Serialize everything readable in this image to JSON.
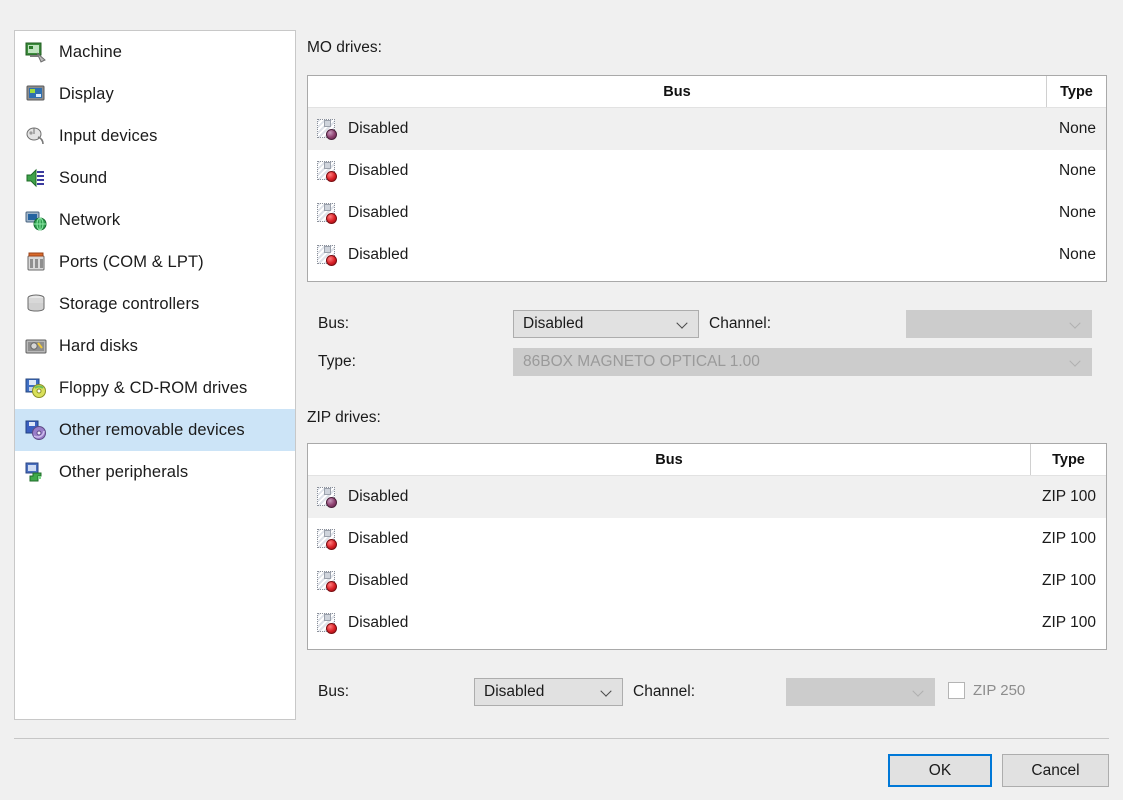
{
  "sidebar": {
    "items": [
      {
        "label": "Machine",
        "icon": "machine-icon",
        "selected": false
      },
      {
        "label": "Display",
        "icon": "display-icon",
        "selected": false
      },
      {
        "label": "Input devices",
        "icon": "input-devices-icon",
        "selected": false
      },
      {
        "label": "Sound",
        "icon": "sound-icon",
        "selected": false
      },
      {
        "label": "Network",
        "icon": "network-icon",
        "selected": false
      },
      {
        "label": "Ports (COM & LPT)",
        "icon": "ports-icon",
        "selected": false
      },
      {
        "label": "Storage controllers",
        "icon": "storage-controllers-icon",
        "selected": false
      },
      {
        "label": "Hard disks",
        "icon": "hard-disks-icon",
        "selected": false
      },
      {
        "label": "Floppy & CD-ROM drives",
        "icon": "floppy-cdrom-icon",
        "selected": false
      },
      {
        "label": "Other removable devices",
        "icon": "removable-devices-icon",
        "selected": true
      },
      {
        "label": "Other peripherals",
        "icon": "other-peripherals-icon",
        "selected": false
      }
    ]
  },
  "mo_section": {
    "title": "MO drives:",
    "columns": {
      "bus": "Bus",
      "type": "Type"
    },
    "rows": [
      {
        "bus": "Disabled",
        "type": "None",
        "selected": true
      },
      {
        "bus": "Disabled",
        "type": "None",
        "selected": false
      },
      {
        "bus": "Disabled",
        "type": "None",
        "selected": false
      },
      {
        "bus": "Disabled",
        "type": "None",
        "selected": false
      }
    ],
    "bus_label": "Bus:",
    "bus_value": "Disabled",
    "channel_label": "Channel:",
    "channel_value": "",
    "type_label": "Type:",
    "type_value": "86BOX MAGNETO OPTICAL 1.00"
  },
  "zip_section": {
    "title": "ZIP drives:",
    "columns": {
      "bus": "Bus",
      "type": "Type"
    },
    "rows": [
      {
        "bus": "Disabled",
        "type": "ZIP 100",
        "selected": true
      },
      {
        "bus": "Disabled",
        "type": "ZIP 100",
        "selected": false
      },
      {
        "bus": "Disabled",
        "type": "ZIP 100",
        "selected": false
      },
      {
        "bus": "Disabled",
        "type": "ZIP 100",
        "selected": false
      }
    ],
    "bus_label": "Bus:",
    "bus_value": "Disabled",
    "channel_label": "Channel:",
    "channel_value": "",
    "zip250_label": "ZIP 250",
    "zip250_checked": false
  },
  "footer": {
    "ok_label": "OK",
    "cancel_label": "Cancel"
  },
  "colors": {
    "window_bg": "#f0f0f0",
    "selection_blue": "#cce4f7",
    "row_selection": "#f0f0f0",
    "accent_focus": "#0078d7",
    "text": "#1b1b1b",
    "disabled_text": "#9a9a9a",
    "combo_bg": "#e1e1e1",
    "combo_disabled_bg": "#cccccc"
  }
}
